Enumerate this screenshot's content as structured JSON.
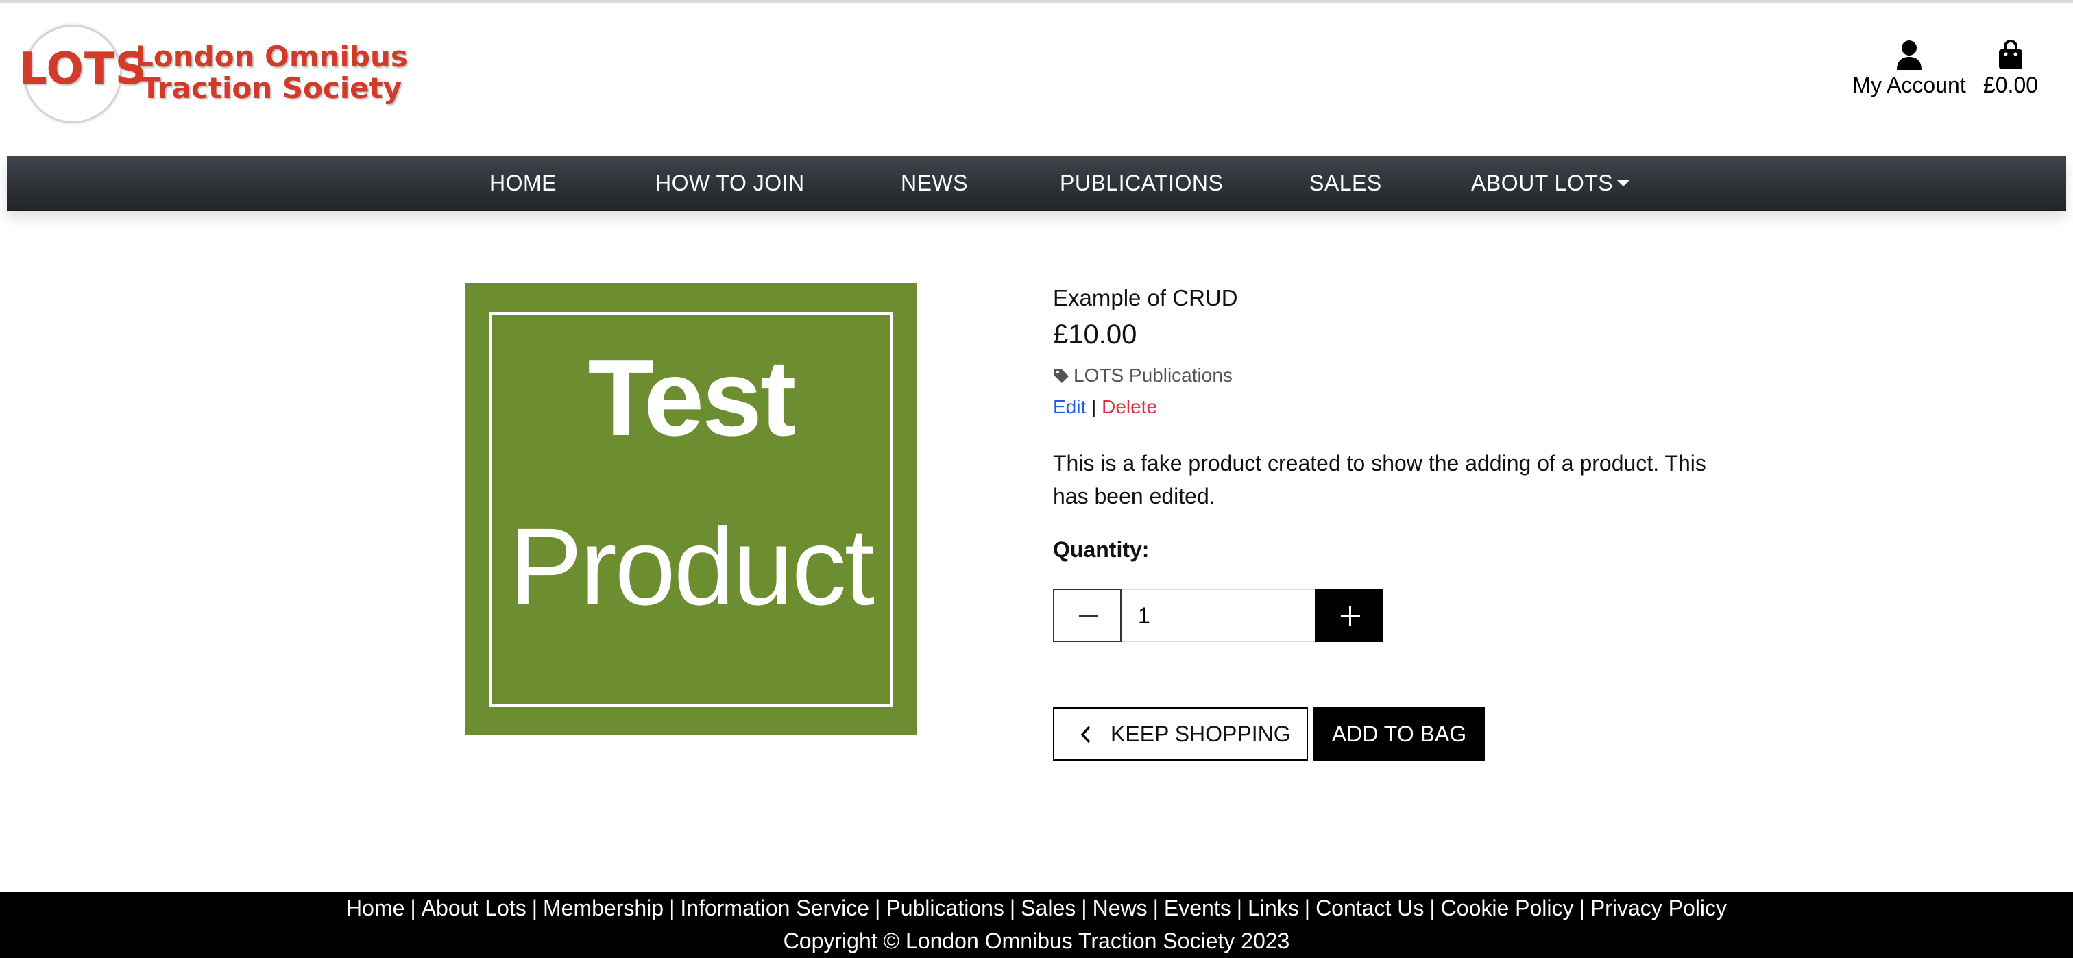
{
  "header": {
    "logo_abbr": "LOTS",
    "logo_name_line1": "London Omnibus",
    "logo_name_line2": "Traction Society",
    "account_label": "My Account",
    "bag_total": "£0.00"
  },
  "nav": {
    "items": [
      "HOME",
      "HOW TO JOIN",
      "NEWS",
      "PUBLICATIONS",
      "SALES",
      "ABOUT LOTS"
    ]
  },
  "product": {
    "image_text_line1": "Test",
    "image_text_line2": "Product",
    "image_color": "#6c8e31",
    "title": "Example of CRUD",
    "price": "£10.00",
    "category": "LOTS Publications",
    "edit_label": "Edit",
    "link_separator": "|",
    "delete_label": "Delete",
    "description": "This is a fake product created to show the adding of a product. This has been edited.",
    "quantity_label": "Quantity:",
    "quantity_value": "1"
  },
  "actions": {
    "keep_shopping": "KEEP SHOPPING",
    "add_to_bag": "ADD TO BAG"
  },
  "footer": {
    "links": [
      "Home",
      "About Lots",
      "Membership",
      "Information Service",
      "Publications",
      "Sales",
      "News",
      "Events",
      "Links",
      "Contact Us",
      "Cookie Policy",
      "Privacy Policy"
    ],
    "separator": "|",
    "copyright": "Copyright © London Omnibus Traction Society 2023"
  },
  "colors": {
    "brand_red": "#d23a2a",
    "nav_dark": "#212529",
    "edit_link": "#1a5ce6",
    "delete_link": "#d63340"
  },
  "icons": [
    "user-icon",
    "shopping-bag-icon",
    "tag-icon",
    "minus-icon",
    "plus-icon",
    "chevron-left-icon",
    "caret-down-icon"
  ]
}
